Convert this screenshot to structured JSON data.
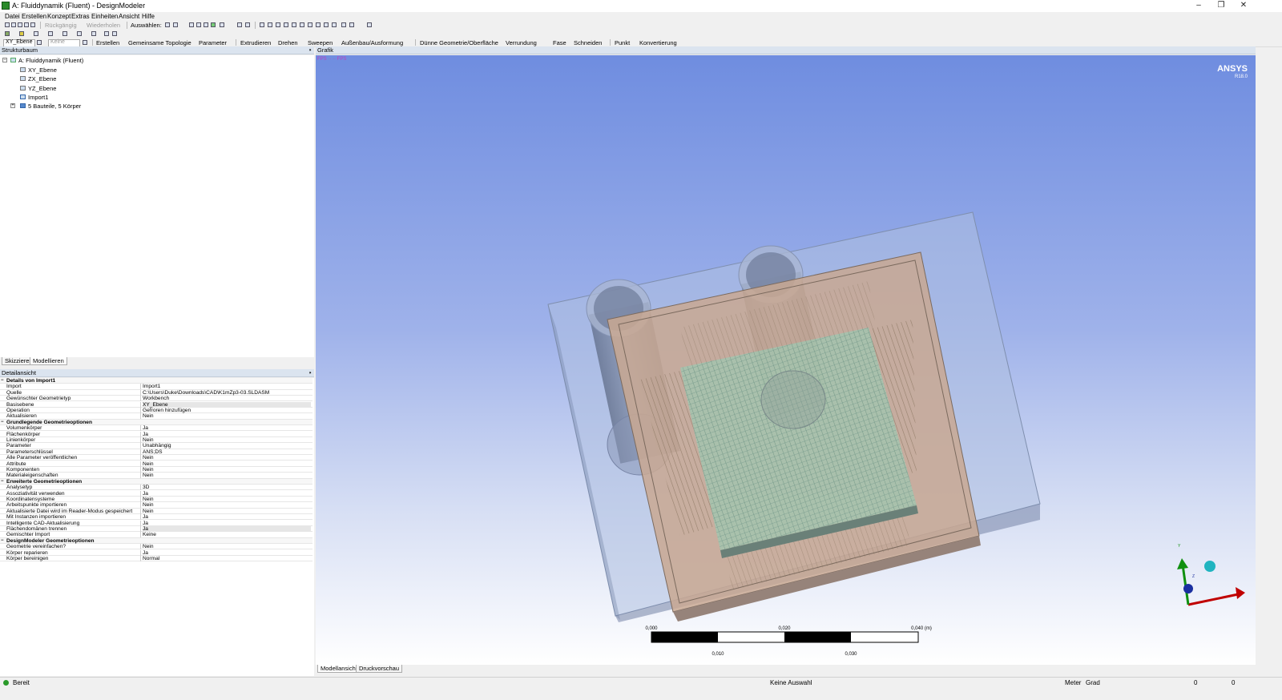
{
  "window": {
    "title": "A: Fluiddynamik (Fluent) - DesignModeler",
    "controls": [
      "–",
      "❐",
      "✕"
    ]
  },
  "menu": [
    "Datei",
    "Erstellen",
    "Konzept",
    "Extras",
    "Einheiten",
    "Ansicht",
    "Hilfe"
  ],
  "toolbar1": {
    "undo_label": "Rückgängig",
    "redo_label": "Wiederholen",
    "select_label": "Auswählen:"
  },
  "toolbar3": {
    "plane_select": "XY_Ebene",
    "sketch_select": "Keine",
    "items": [
      "Erstellen",
      "Gemeinsame Topologie",
      "Parameter",
      "Extrudieren",
      "Drehen",
      "Sweepen",
      "Außenbau/Ausformung",
      "Dünne Geometrie/Oberfläche",
      "Verrundung",
      "Fase",
      "Schneiden",
      "Punkt",
      "Konvertierung"
    ]
  },
  "tree": {
    "panel_title": "Strukturbaum",
    "root": "A: Fluiddynamik (Fluent)",
    "items": [
      "XY_Ebene",
      "ZX_Ebene",
      "YZ_Ebene",
      "Import1",
      "5 Bauteile, 5 Körper"
    ],
    "expanders": [
      "−",
      "+"
    ]
  },
  "tabs": [
    "Skizzieren",
    "Modellieren"
  ],
  "details": {
    "panel_title": "Detailansicht",
    "rows": [
      {
        "section": "Details von Import1"
      },
      {
        "k": "Import",
        "v": "Import1"
      },
      {
        "k": "Quelle",
        "v": "C:\\Users\\Duke\\Downloads\\CAD\\K1mZp3-03.SLDASM"
      },
      {
        "k": "Gewünschter Geometrietyp",
        "v": "Workbench"
      },
      {
        "k": "Basisebene",
        "v": "XY_Ebene",
        "hl": true
      },
      {
        "k": "Operation",
        "v": "Gefroren hinzufügen"
      },
      {
        "k": "Aktualisieren",
        "v": "Nein"
      },
      {
        "section": "Grundlegende Geometrieoptionen"
      },
      {
        "k": "Volumenkörper",
        "v": "Ja"
      },
      {
        "k": "Flächenkörper",
        "v": "Ja"
      },
      {
        "k": "Linienkörper",
        "v": "Nein"
      },
      {
        "k": "Parameter",
        "v": "Unabhängig"
      },
      {
        "k": "Parameterschlüssel",
        "v": "ANS;DS"
      },
      {
        "k": "Alle Parameter veröffentlichen",
        "v": "Nein"
      },
      {
        "k": "Attribute",
        "v": "Nein"
      },
      {
        "k": "Komponenten",
        "v": "Nein"
      },
      {
        "k": "Materialeigenschaften",
        "v": "Nein"
      },
      {
        "section": "Erweiterte Geometrieoptionen"
      },
      {
        "k": "Analysetyp",
        "v": "3D"
      },
      {
        "k": "Assoziativität verwenden",
        "v": "Ja"
      },
      {
        "k": "Koordinatensysteme",
        "v": "Nein"
      },
      {
        "k": "Arbeitspunkte importieren",
        "v": "Nein"
      },
      {
        "k": "Aktualisierte Datei wird im Reader-Modus gespeichert",
        "v": "Nein"
      },
      {
        "k": "Mit Instanzen importieren",
        "v": "Ja"
      },
      {
        "k": "Intelligente CAD-Aktualisierung",
        "v": "Ja"
      },
      {
        "k": "Flächendomänen trennen",
        "v": "Ja",
        "hl": true
      },
      {
        "k": "Gemischter Import",
        "v": "Keine"
      },
      {
        "section": "DesignModeler Geometrieoptionen"
      },
      {
        "k": "Geometrie vereinfachen?",
        "v": "Nein"
      },
      {
        "k": "Körper reparieren",
        "v": "Ja"
      },
      {
        "k": "Körper bereinigen",
        "v": "Normal"
      }
    ]
  },
  "graphics": {
    "panel_title": "Grafik",
    "brand": "ANSYS",
    "version": "R18.0",
    "scale_top": [
      "0,000",
      "0,020",
      "0,040 (m)"
    ],
    "scale_bottom": [
      "0,010",
      "0,030"
    ],
    "triad_labels": [
      "Y",
      "Z"
    ],
    "view_tabs": [
      "Modellansicht",
      "Druckvorschau"
    ],
    "colors": {
      "background_top": "#6f8de0",
      "axis_x": "#c00000",
      "axis_y": "#109010",
      "axis_z": "#1a2fa0",
      "iso_ball": "#20b4c0"
    }
  },
  "status": {
    "ready": "Bereit",
    "selection": "Keine Auswahl",
    "unit_length": "Meter",
    "unit_angle": "Grad",
    "val1": "0",
    "val2": "0"
  },
  "icons": [
    "app-icon",
    "pin-icon",
    "plane-icon",
    "sketch-icon",
    "import-icon",
    "parts-icon",
    "status-icon"
  ]
}
